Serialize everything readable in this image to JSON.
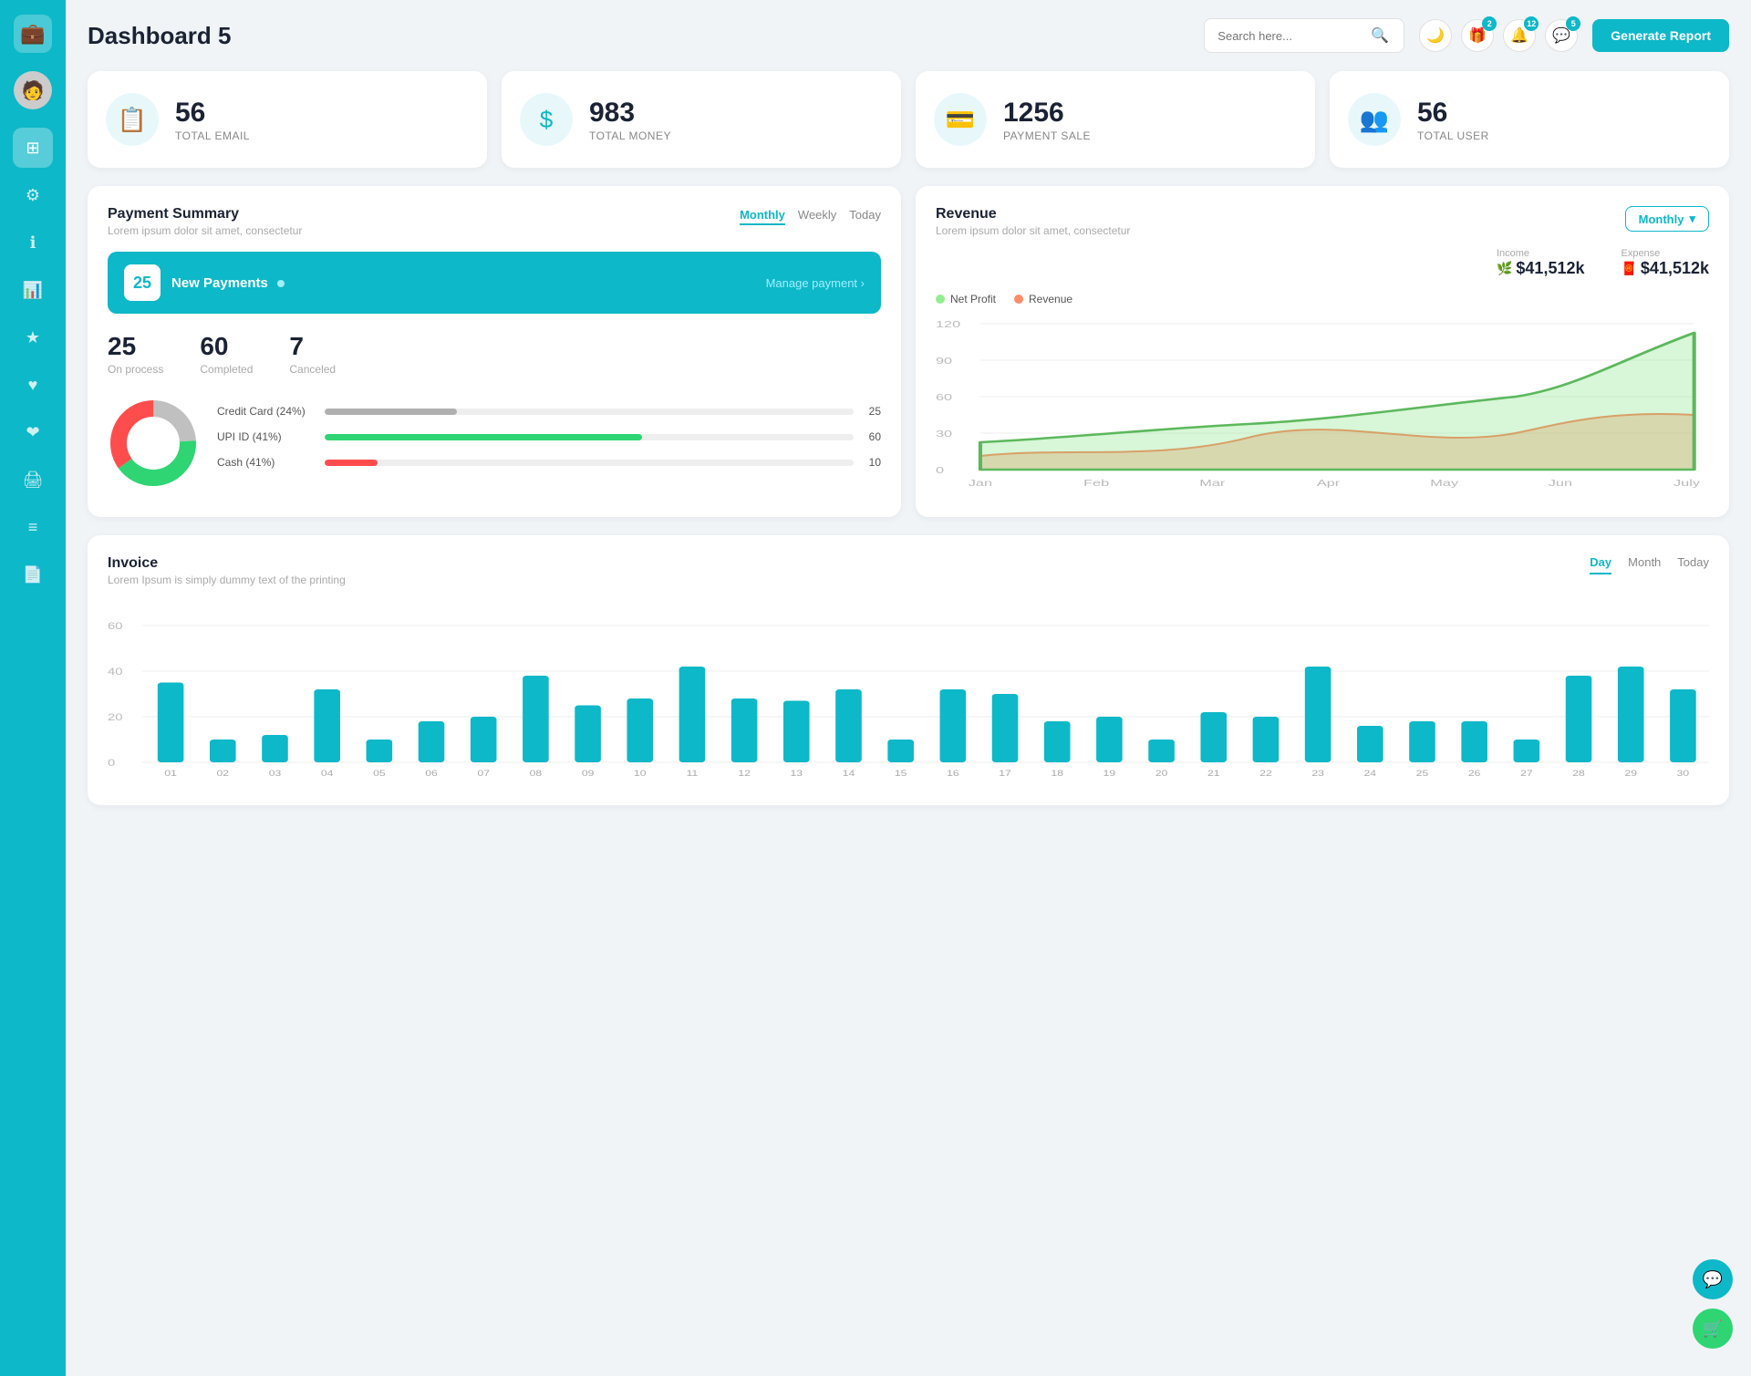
{
  "app": {
    "title": "Dashboard 5"
  },
  "header": {
    "search_placeholder": "Search here...",
    "generate_btn": "Generate Report",
    "badges": {
      "gift": "2",
      "bell": "12",
      "chat": "5"
    }
  },
  "stat_cards": [
    {
      "id": "email",
      "number": "56",
      "label": "TOTAL EMAIL",
      "icon": "📋"
    },
    {
      "id": "money",
      "number": "983",
      "label": "TOTAL MONEY",
      "icon": "$"
    },
    {
      "id": "payment",
      "number": "1256",
      "label": "PAYMENT SALE",
      "icon": "💳"
    },
    {
      "id": "user",
      "number": "56",
      "label": "TOTAL USER",
      "icon": "👥"
    }
  ],
  "payment_summary": {
    "title": "Payment Summary",
    "subtitle": "Lorem ipsum dolor sit amet, consectetur",
    "tabs": [
      "Monthly",
      "Weekly",
      "Today"
    ],
    "active_tab": "Monthly",
    "new_payments": {
      "count": "25",
      "label": "New Payments",
      "manage_link": "Manage payment ›"
    },
    "stats": [
      {
        "num": "25",
        "label": "On process"
      },
      {
        "num": "60",
        "label": "Completed"
      },
      {
        "num": "7",
        "label": "Canceled"
      }
    ],
    "methods": [
      {
        "name": "Credit Card (24%)",
        "value": 25,
        "max": 100,
        "color": "#b0b0b0",
        "display": "25"
      },
      {
        "name": "UPI ID (41%)",
        "value": 60,
        "max": 100,
        "color": "#2ed572",
        "display": "60"
      },
      {
        "name": "Cash (41%)",
        "value": 10,
        "max": 100,
        "color": "#ff4d4d",
        "display": "10"
      }
    ],
    "donut": {
      "segments": [
        {
          "label": "Credit Card",
          "pct": 24,
          "color": "#b0b0b0"
        },
        {
          "label": "UPI",
          "pct": 41,
          "color": "#2ed572"
        },
        {
          "label": "Cash",
          "pct": 35,
          "color": "#ff4d4d"
        }
      ]
    }
  },
  "revenue": {
    "title": "Revenue",
    "subtitle": "Lorem ipsum dolor sit amet, consectetur",
    "dropdown": "Monthly",
    "income": {
      "label": "Income",
      "amount": "$41,512k"
    },
    "expense": {
      "label": "Expense",
      "amount": "$41,512k"
    },
    "legend": [
      {
        "label": "Net Profit",
        "color": "#90ee90"
      },
      {
        "label": "Revenue",
        "color": "#ff8c69"
      }
    ],
    "x_labels": [
      "Jan",
      "Feb",
      "Mar",
      "Apr",
      "May",
      "Jun",
      "July"
    ],
    "y_labels": [
      "0",
      "30",
      "60",
      "90",
      "120"
    ]
  },
  "invoice": {
    "title": "Invoice",
    "subtitle": "Lorem Ipsum is simply dummy text of the printing",
    "tabs": [
      "Day",
      "Month",
      "Today"
    ],
    "active_tab": "Day",
    "y_labels": [
      "0",
      "20",
      "40",
      "60"
    ],
    "x_labels": [
      "01",
      "02",
      "03",
      "04",
      "05",
      "06",
      "07",
      "08",
      "09",
      "10",
      "11",
      "12",
      "13",
      "14",
      "15",
      "16",
      "17",
      "18",
      "19",
      "20",
      "21",
      "22",
      "23",
      "24",
      "25",
      "26",
      "27",
      "28",
      "29",
      "30"
    ],
    "bars": [
      35,
      10,
      12,
      32,
      10,
      18,
      20,
      38,
      25,
      28,
      42,
      28,
      27,
      32,
      10,
      32,
      30,
      18,
      20,
      10,
      22,
      20,
      42,
      16,
      18,
      18,
      10,
      38,
      42,
      32
    ]
  }
}
